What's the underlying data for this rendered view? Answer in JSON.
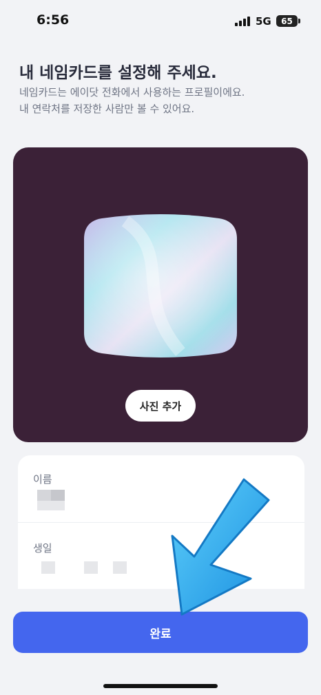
{
  "status_bar": {
    "time": "6:56",
    "network": "5G",
    "battery": "65"
  },
  "header": {
    "title": "내 네임카드를 설정해 주세요.",
    "subtitle_line1": "네임카드는 에이닷 전화에서 사용하는 프로필이에요.",
    "subtitle_line2": "내 연락처를 저장한 사람만 볼 수 있어요."
  },
  "card": {
    "add_photo_label": "사진 추가"
  },
  "form": {
    "name_label": "이름",
    "birthday_label": "생일"
  },
  "footer": {
    "complete_label": "완료"
  },
  "colors": {
    "card_bg": "#3b2137",
    "primary": "#4466ee",
    "arrow": "#2aa8f0"
  },
  "icons": {
    "annotation": "arrow-down-left-icon"
  }
}
